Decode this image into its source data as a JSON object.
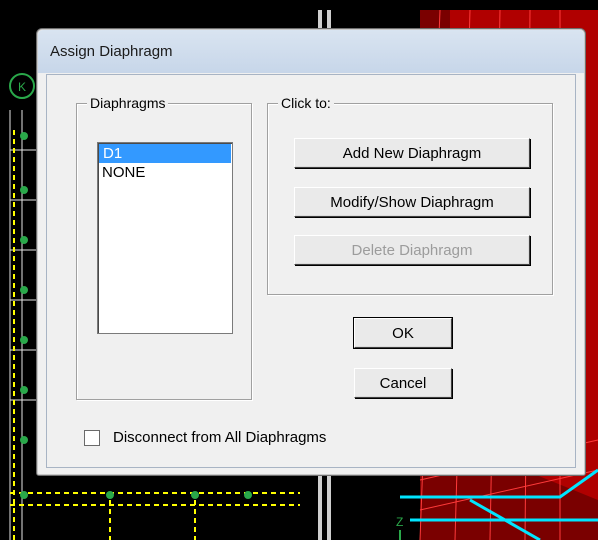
{
  "dialog": {
    "title": "Assign Diaphragm",
    "diaphragms_label": "Diaphragms",
    "diaphragms": [
      {
        "label": "D1",
        "selected": true
      },
      {
        "label": "NONE",
        "selected": false
      }
    ],
    "click_to_label": "Click to:",
    "add_button": "Add New Diaphragm",
    "modify_button": "Modify/Show Diaphragm",
    "delete_button": "Delete Diaphragm",
    "delete_enabled": false,
    "ok_button": "OK",
    "cancel_button": "Cancel",
    "disconnect_label": "Disconnect from All Diaphragms",
    "disconnect_checked": false
  },
  "colors": {
    "selection": "#3399ff",
    "titlebar": "#c7d6e9",
    "background_model_red": "#d20000",
    "background_model_green": "#2aa84a",
    "background_model_yellow": "#ffff00"
  },
  "background": {
    "grid_bubble_label": "K",
    "axis_label": "Z"
  }
}
